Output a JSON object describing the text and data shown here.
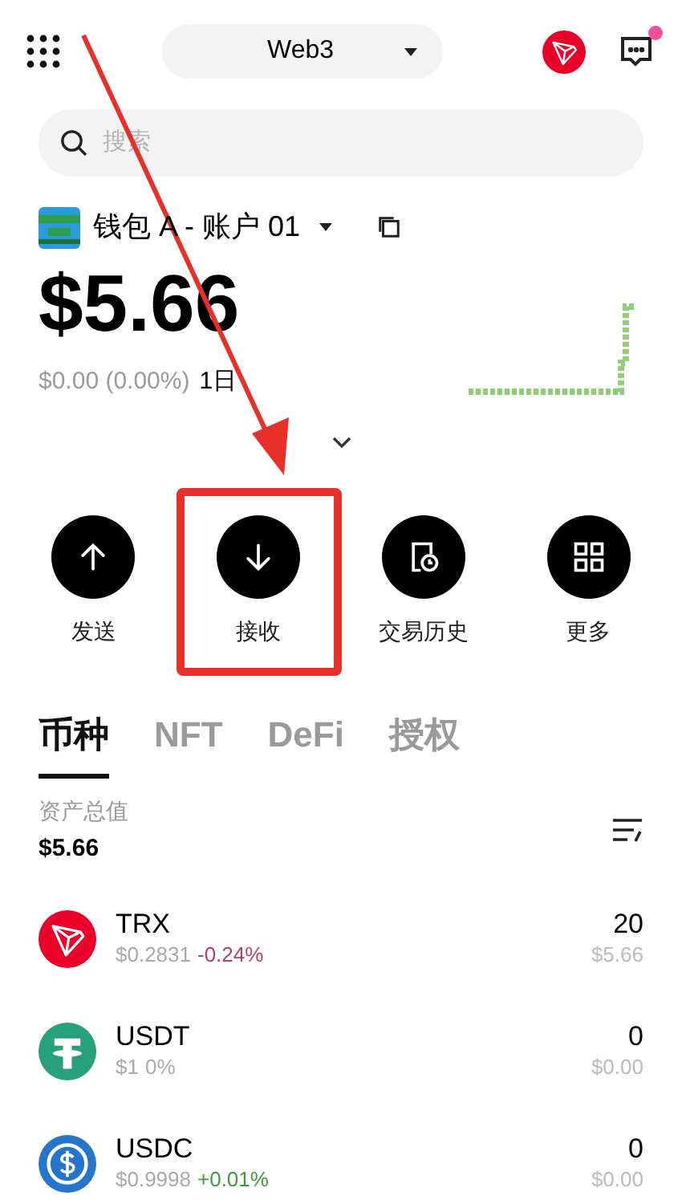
{
  "header": {
    "network": "Web3",
    "has_notification": true
  },
  "search": {
    "placeholder": "搜索"
  },
  "account": {
    "name": "钱包 A - 账户 01"
  },
  "balance": {
    "amount": "$5.66",
    "change": "$0.00 (0.00%)",
    "period": "1日"
  },
  "actions": [
    {
      "kind": "send",
      "label": "发送",
      "highlighted": false
    },
    {
      "kind": "receive",
      "label": "接收",
      "highlighted": true
    },
    {
      "kind": "history",
      "label": "交易历史",
      "highlighted": false
    },
    {
      "kind": "more",
      "label": "更多",
      "highlighted": false
    }
  ],
  "tabs": [
    {
      "label": "币种",
      "selected": true
    },
    {
      "label": "NFT",
      "selected": false
    },
    {
      "label": "DeFi",
      "selected": false
    },
    {
      "label": "授权",
      "selected": false
    }
  ],
  "total": {
    "label": "资产总值",
    "value": "$5.66"
  },
  "tokens": [
    {
      "kind": "trx",
      "symbol": "TRX",
      "price": "$0.2831",
      "change": "-0.24%",
      "color": "#b0416b",
      "amount": "20",
      "value": "$5.66"
    },
    {
      "kind": "usdt",
      "symbol": "USDT",
      "price": "$1",
      "change": "0%",
      "color": "#aaaaaa",
      "amount": "0",
      "value": "$0.00"
    },
    {
      "kind": "usdc",
      "symbol": "USDC",
      "price": "$0.9998",
      "change": "+0.01%",
      "color": "#3f9a3f",
      "amount": "0",
      "value": "$0.00"
    }
  ]
}
